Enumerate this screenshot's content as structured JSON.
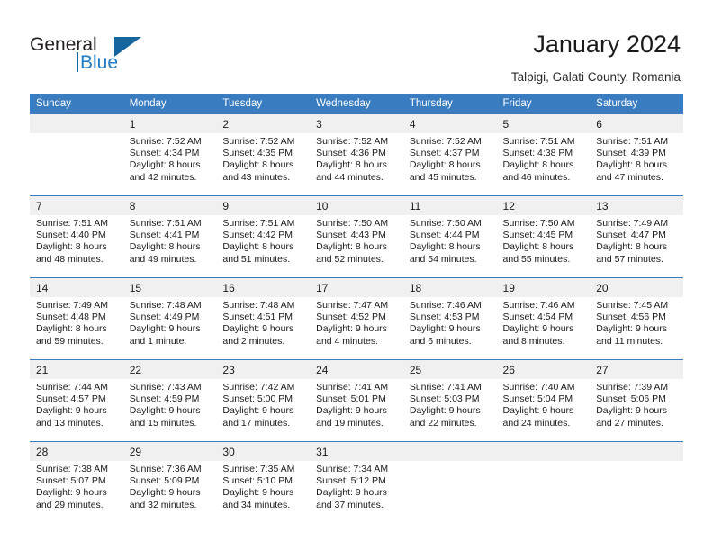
{
  "brand": {
    "name_part1": "General",
    "name_part2": "Blue",
    "logo_icon": "blue-triangle-icon"
  },
  "header": {
    "title": "January 2024",
    "subtitle": "Talpigi, Galati County, Romania"
  },
  "colors": {
    "header_blue": "#3a7cc0",
    "daynum_band": "#f0f0f0",
    "brand_blue": "#1f7ac4",
    "text": "#1a1a1a"
  },
  "weekday_headers": [
    "Sunday",
    "Monday",
    "Tuesday",
    "Wednesday",
    "Thursday",
    "Friday",
    "Saturday"
  ],
  "calendar": {
    "month": "January",
    "year": "2024",
    "first_day_column": "Monday",
    "weeks": [
      [
        {
          "day": "",
          "empty": true,
          "sunrise": "",
          "sunset": "",
          "daylight_line1": "",
          "daylight_line2": ""
        },
        {
          "day": "1",
          "empty": false,
          "sunrise": "Sunrise: 7:52 AM",
          "sunset": "Sunset: 4:34 PM",
          "daylight_line1": "Daylight: 8 hours",
          "daylight_line2": "and 42 minutes."
        },
        {
          "day": "2",
          "empty": false,
          "sunrise": "Sunrise: 7:52 AM",
          "sunset": "Sunset: 4:35 PM",
          "daylight_line1": "Daylight: 8 hours",
          "daylight_line2": "and 43 minutes."
        },
        {
          "day": "3",
          "empty": false,
          "sunrise": "Sunrise: 7:52 AM",
          "sunset": "Sunset: 4:36 PM",
          "daylight_line1": "Daylight: 8 hours",
          "daylight_line2": "and 44 minutes."
        },
        {
          "day": "4",
          "empty": false,
          "sunrise": "Sunrise: 7:52 AM",
          "sunset": "Sunset: 4:37 PM",
          "daylight_line1": "Daylight: 8 hours",
          "daylight_line2": "and 45 minutes."
        },
        {
          "day": "5",
          "empty": false,
          "sunrise": "Sunrise: 7:51 AM",
          "sunset": "Sunset: 4:38 PM",
          "daylight_line1": "Daylight: 8 hours",
          "daylight_line2": "and 46 minutes."
        },
        {
          "day": "6",
          "empty": false,
          "sunrise": "Sunrise: 7:51 AM",
          "sunset": "Sunset: 4:39 PM",
          "daylight_line1": "Daylight: 8 hours",
          "daylight_line2": "and 47 minutes."
        }
      ],
      [
        {
          "day": "7",
          "empty": false,
          "sunrise": "Sunrise: 7:51 AM",
          "sunset": "Sunset: 4:40 PM",
          "daylight_line1": "Daylight: 8 hours",
          "daylight_line2": "and 48 minutes."
        },
        {
          "day": "8",
          "empty": false,
          "sunrise": "Sunrise: 7:51 AM",
          "sunset": "Sunset: 4:41 PM",
          "daylight_line1": "Daylight: 8 hours",
          "daylight_line2": "and 49 minutes."
        },
        {
          "day": "9",
          "empty": false,
          "sunrise": "Sunrise: 7:51 AM",
          "sunset": "Sunset: 4:42 PM",
          "daylight_line1": "Daylight: 8 hours",
          "daylight_line2": "and 51 minutes."
        },
        {
          "day": "10",
          "empty": false,
          "sunrise": "Sunrise: 7:50 AM",
          "sunset": "Sunset: 4:43 PM",
          "daylight_line1": "Daylight: 8 hours",
          "daylight_line2": "and 52 minutes."
        },
        {
          "day": "11",
          "empty": false,
          "sunrise": "Sunrise: 7:50 AM",
          "sunset": "Sunset: 4:44 PM",
          "daylight_line1": "Daylight: 8 hours",
          "daylight_line2": "and 54 minutes."
        },
        {
          "day": "12",
          "empty": false,
          "sunrise": "Sunrise: 7:50 AM",
          "sunset": "Sunset: 4:45 PM",
          "daylight_line1": "Daylight: 8 hours",
          "daylight_line2": "and 55 minutes."
        },
        {
          "day": "13",
          "empty": false,
          "sunrise": "Sunrise: 7:49 AM",
          "sunset": "Sunset: 4:47 PM",
          "daylight_line1": "Daylight: 8 hours",
          "daylight_line2": "and 57 minutes."
        }
      ],
      [
        {
          "day": "14",
          "empty": false,
          "sunrise": "Sunrise: 7:49 AM",
          "sunset": "Sunset: 4:48 PM",
          "daylight_line1": "Daylight: 8 hours",
          "daylight_line2": "and 59 minutes."
        },
        {
          "day": "15",
          "empty": false,
          "sunrise": "Sunrise: 7:48 AM",
          "sunset": "Sunset: 4:49 PM",
          "daylight_line1": "Daylight: 9 hours",
          "daylight_line2": "and 1 minute."
        },
        {
          "day": "16",
          "empty": false,
          "sunrise": "Sunrise: 7:48 AM",
          "sunset": "Sunset: 4:51 PM",
          "daylight_line1": "Daylight: 9 hours",
          "daylight_line2": "and 2 minutes."
        },
        {
          "day": "17",
          "empty": false,
          "sunrise": "Sunrise: 7:47 AM",
          "sunset": "Sunset: 4:52 PM",
          "daylight_line1": "Daylight: 9 hours",
          "daylight_line2": "and 4 minutes."
        },
        {
          "day": "18",
          "empty": false,
          "sunrise": "Sunrise: 7:46 AM",
          "sunset": "Sunset: 4:53 PM",
          "daylight_line1": "Daylight: 9 hours",
          "daylight_line2": "and 6 minutes."
        },
        {
          "day": "19",
          "empty": false,
          "sunrise": "Sunrise: 7:46 AM",
          "sunset": "Sunset: 4:54 PM",
          "daylight_line1": "Daylight: 9 hours",
          "daylight_line2": "and 8 minutes."
        },
        {
          "day": "20",
          "empty": false,
          "sunrise": "Sunrise: 7:45 AM",
          "sunset": "Sunset: 4:56 PM",
          "daylight_line1": "Daylight: 9 hours",
          "daylight_line2": "and 11 minutes."
        }
      ],
      [
        {
          "day": "21",
          "empty": false,
          "sunrise": "Sunrise: 7:44 AM",
          "sunset": "Sunset: 4:57 PM",
          "daylight_line1": "Daylight: 9 hours",
          "daylight_line2": "and 13 minutes."
        },
        {
          "day": "22",
          "empty": false,
          "sunrise": "Sunrise: 7:43 AM",
          "sunset": "Sunset: 4:59 PM",
          "daylight_line1": "Daylight: 9 hours",
          "daylight_line2": "and 15 minutes."
        },
        {
          "day": "23",
          "empty": false,
          "sunrise": "Sunrise: 7:42 AM",
          "sunset": "Sunset: 5:00 PM",
          "daylight_line1": "Daylight: 9 hours",
          "daylight_line2": "and 17 minutes."
        },
        {
          "day": "24",
          "empty": false,
          "sunrise": "Sunrise: 7:41 AM",
          "sunset": "Sunset: 5:01 PM",
          "daylight_line1": "Daylight: 9 hours",
          "daylight_line2": "and 19 minutes."
        },
        {
          "day": "25",
          "empty": false,
          "sunrise": "Sunrise: 7:41 AM",
          "sunset": "Sunset: 5:03 PM",
          "daylight_line1": "Daylight: 9 hours",
          "daylight_line2": "and 22 minutes."
        },
        {
          "day": "26",
          "empty": false,
          "sunrise": "Sunrise: 7:40 AM",
          "sunset": "Sunset: 5:04 PM",
          "daylight_line1": "Daylight: 9 hours",
          "daylight_line2": "and 24 minutes."
        },
        {
          "day": "27",
          "empty": false,
          "sunrise": "Sunrise: 7:39 AM",
          "sunset": "Sunset: 5:06 PM",
          "daylight_line1": "Daylight: 9 hours",
          "daylight_line2": "and 27 minutes."
        }
      ],
      [
        {
          "day": "28",
          "empty": false,
          "sunrise": "Sunrise: 7:38 AM",
          "sunset": "Sunset: 5:07 PM",
          "daylight_line1": "Daylight: 9 hours",
          "daylight_line2": "and 29 minutes."
        },
        {
          "day": "29",
          "empty": false,
          "sunrise": "Sunrise: 7:36 AM",
          "sunset": "Sunset: 5:09 PM",
          "daylight_line1": "Daylight: 9 hours",
          "daylight_line2": "and 32 minutes."
        },
        {
          "day": "30",
          "empty": false,
          "sunrise": "Sunrise: 7:35 AM",
          "sunset": "Sunset: 5:10 PM",
          "daylight_line1": "Daylight: 9 hours",
          "daylight_line2": "and 34 minutes."
        },
        {
          "day": "31",
          "empty": false,
          "sunrise": "Sunrise: 7:34 AM",
          "sunset": "Sunset: 5:12 PM",
          "daylight_line1": "Daylight: 9 hours",
          "daylight_line2": "and 37 minutes."
        },
        {
          "day": "",
          "empty": true,
          "sunrise": "",
          "sunset": "",
          "daylight_line1": "",
          "daylight_line2": ""
        },
        {
          "day": "",
          "empty": true,
          "sunrise": "",
          "sunset": "",
          "daylight_line1": "",
          "daylight_line2": ""
        },
        {
          "day": "",
          "empty": true,
          "sunrise": "",
          "sunset": "",
          "daylight_line1": "",
          "daylight_line2": ""
        }
      ]
    ]
  }
}
